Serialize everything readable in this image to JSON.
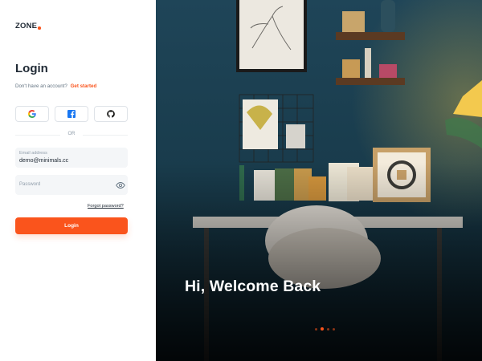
{
  "brand": {
    "name": "ZONE",
    "accent_color": "#fa541c"
  },
  "login_form": {
    "title": "Login",
    "signup_prompt": "Don't have an account?",
    "signup_link": "Get started",
    "social_buttons": [
      {
        "icon": "google-icon"
      },
      {
        "icon": "facebook-icon"
      },
      {
        "icon": "github-icon"
      }
    ],
    "divider_text": "OR",
    "email": {
      "label": "Email address",
      "value": "demo@minimals.cc"
    },
    "password": {
      "placeholder": "Password",
      "toggle_icon": "eye-icon"
    },
    "forgot_password": "Forgot password?",
    "submit_label": "Login"
  },
  "hero": {
    "heading": "Hi, Welcome Back",
    "carousel": {
      "count": 4,
      "active_index": 1
    }
  }
}
